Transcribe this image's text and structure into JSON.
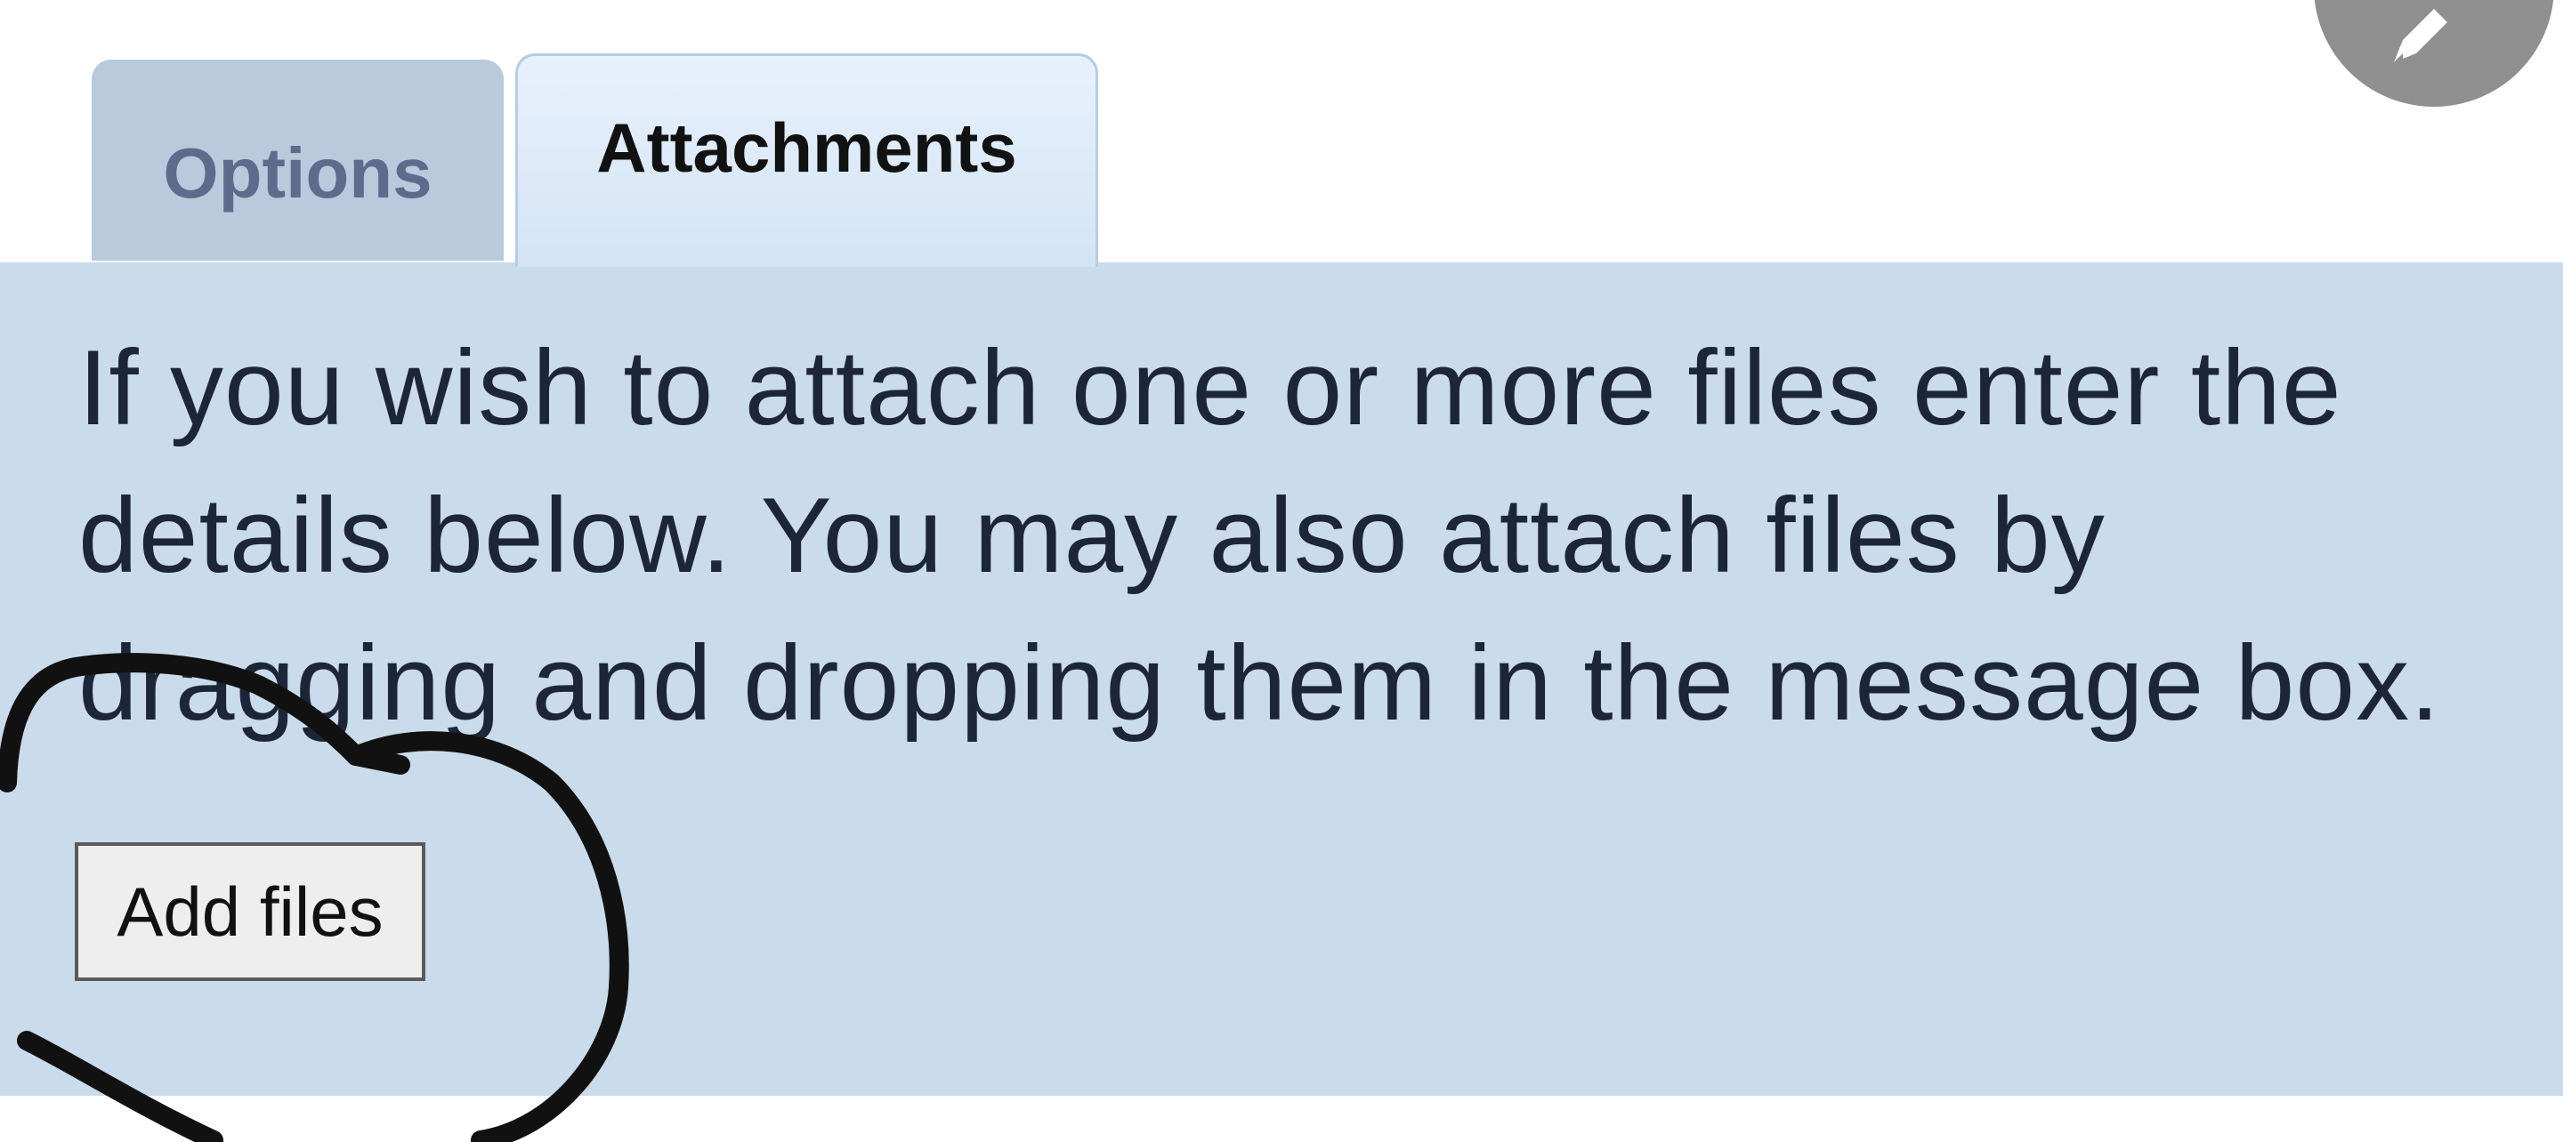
{
  "tabs": {
    "options_label": "Options",
    "attachments_label": "Attachments"
  },
  "panel": {
    "instructions": "If you wish to attach one or more files enter the details below. You may also attach files by dragging and dropping them in the message box."
  },
  "buttons": {
    "add_files_label": "Add files"
  },
  "colors": {
    "panel_bg": "#cadbeb",
    "tab_inactive_bg": "#b9cadc",
    "tab_active_bg": "#d4e4f5",
    "text": "#1d2637",
    "annotation_ink": "#111111"
  },
  "icons": {
    "fab": "pencil-icon",
    "annotation": "hand-drawn-circle-mark"
  }
}
